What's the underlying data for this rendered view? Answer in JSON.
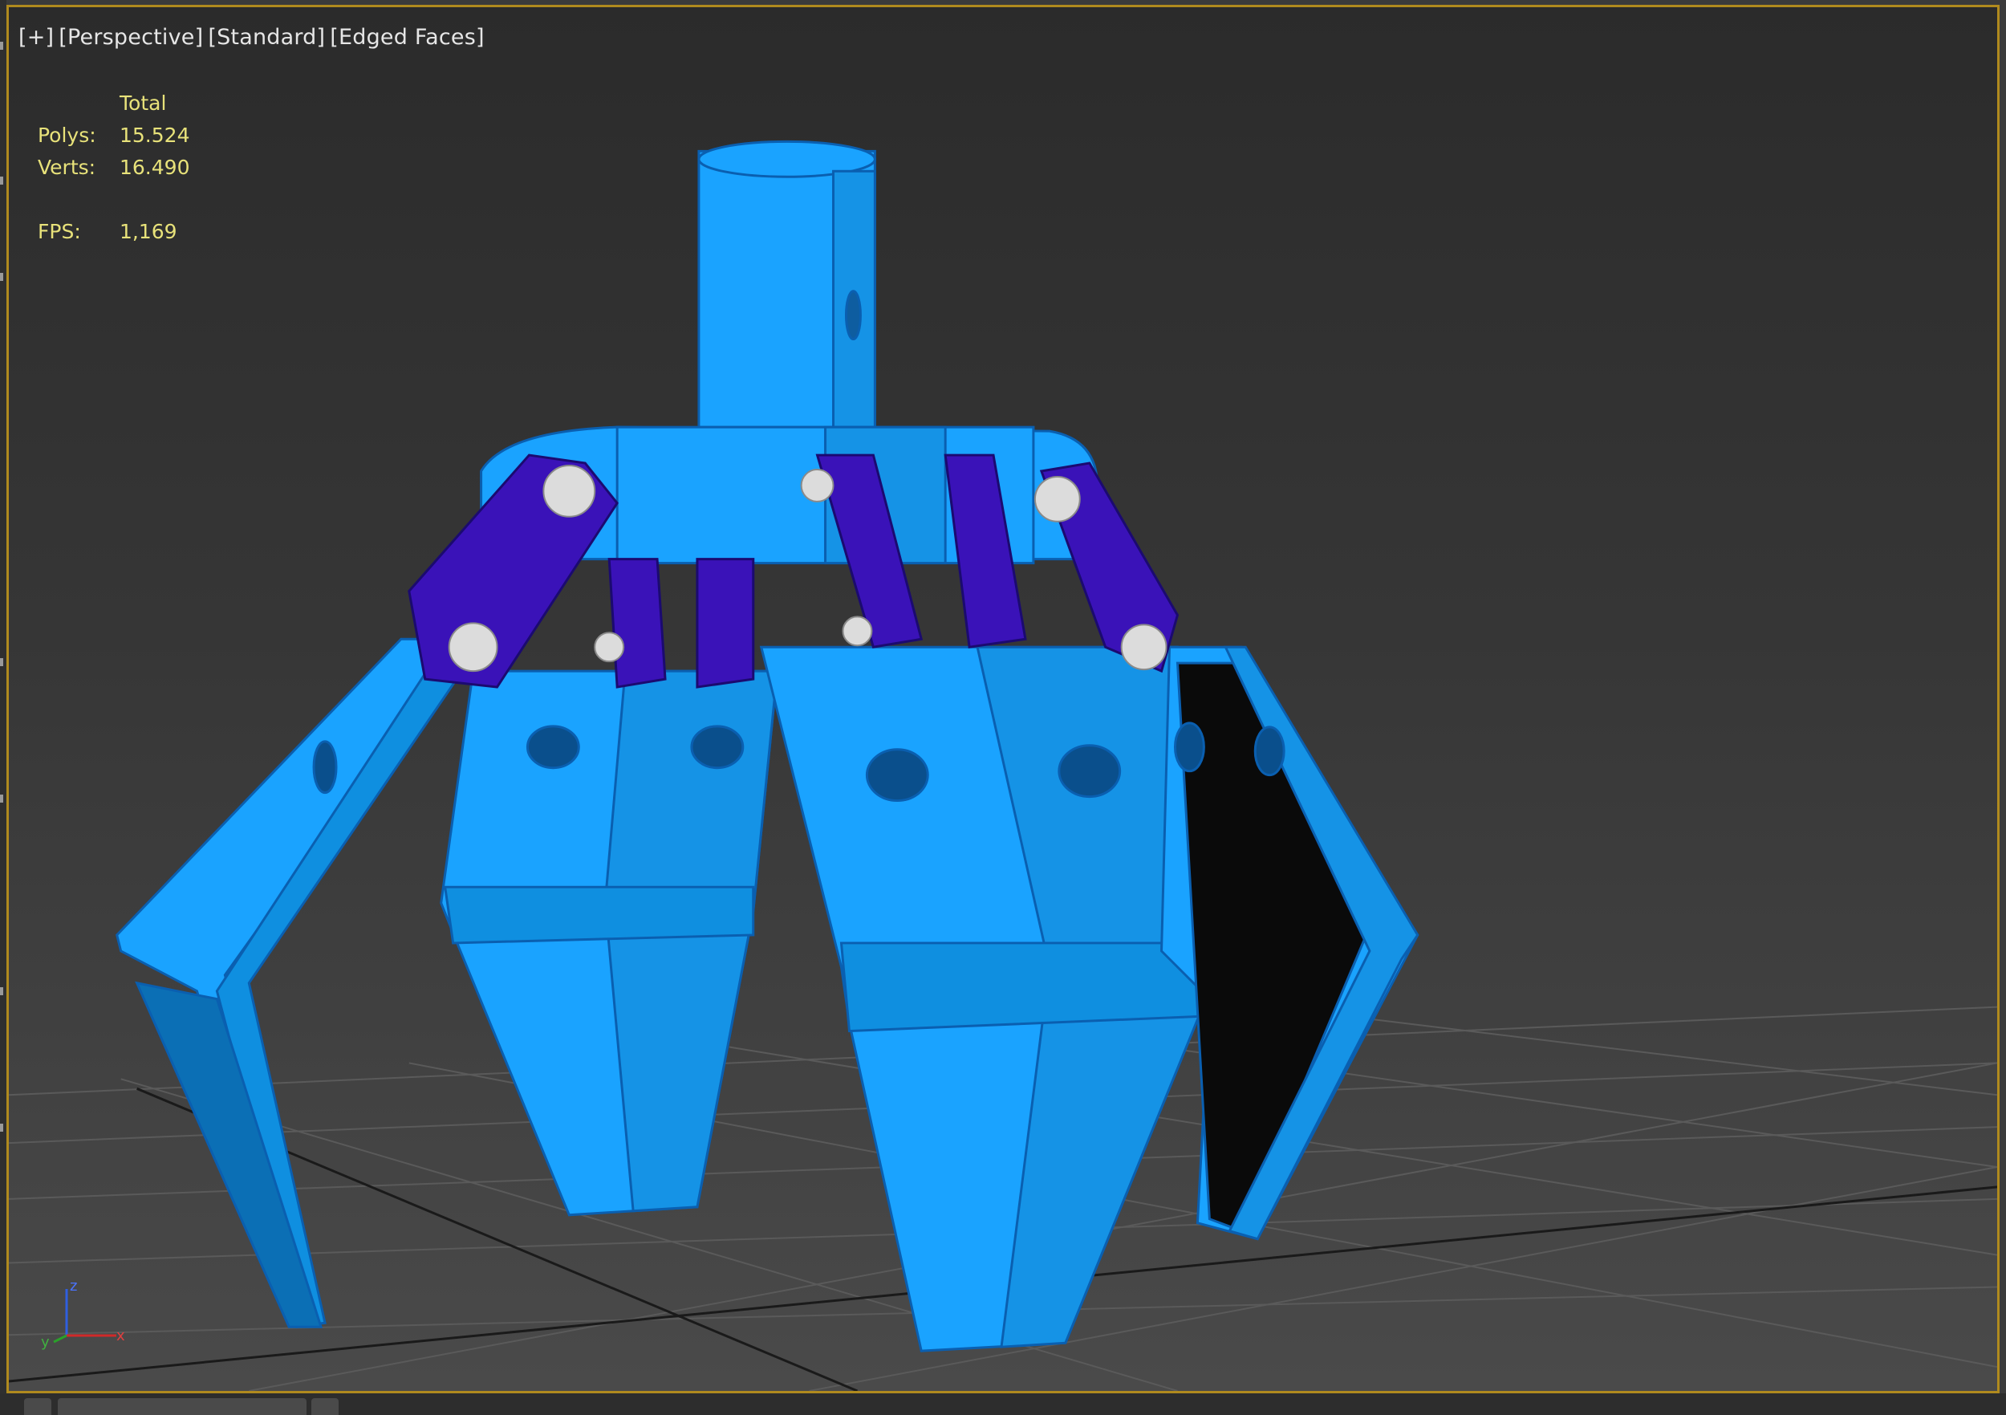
{
  "viewport": {
    "labels": [
      "[+]",
      "[Perspective]",
      "[Standard]",
      "[Edged Faces]"
    ]
  },
  "stats": {
    "header": "Total",
    "polys_label": "Polys:",
    "polys_value": "15.524",
    "verts_label": "Verts:",
    "verts_value": "16.490",
    "fps_label": "FPS:",
    "fps_value": "1,169"
  },
  "gizmo": {
    "z": "z",
    "y": "y",
    "x": "x"
  },
  "colors": {
    "accent_border": "#b08a1e",
    "model_primary": "#1aa3ff",
    "model_links": "#3a12b8",
    "pins": "#dcdcdc",
    "stats_text": "#e8e27a"
  }
}
